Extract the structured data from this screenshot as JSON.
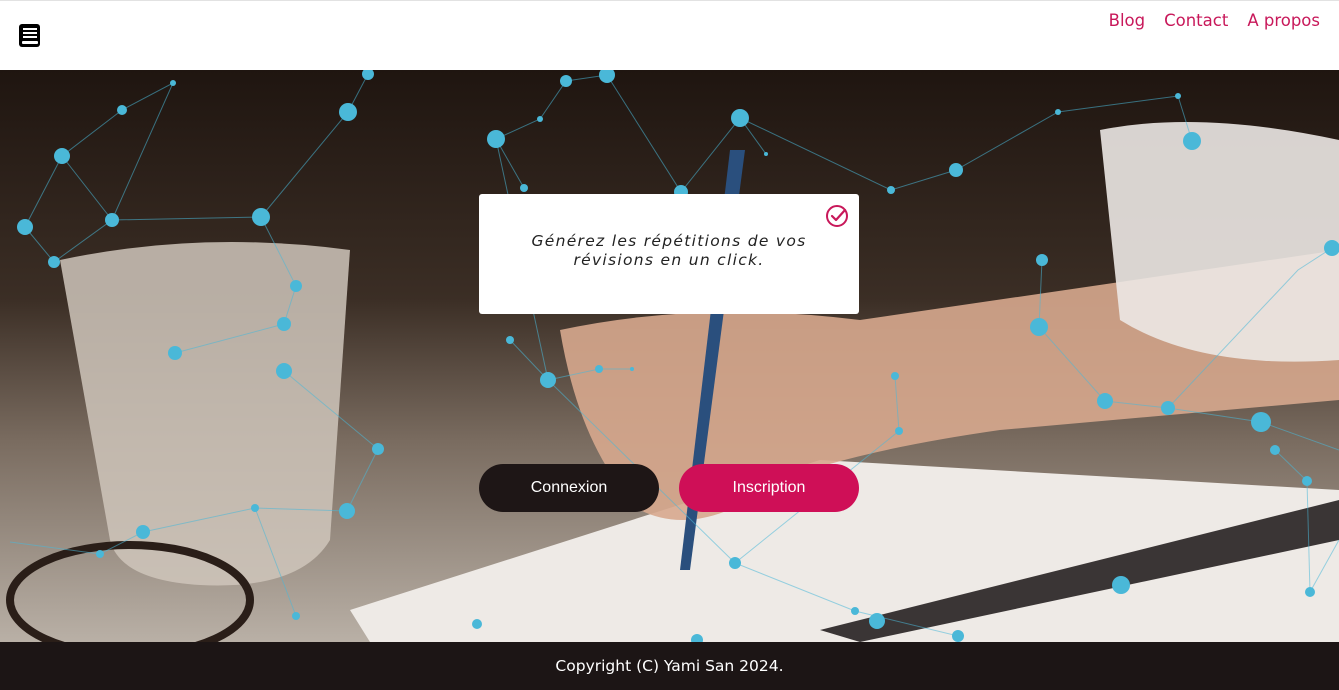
{
  "header": {
    "logo_icon": "book-icon",
    "nav": {
      "blog": "Blog",
      "contact": "Contact",
      "about": "A propos"
    }
  },
  "hero": {
    "tagline": "Générez les répétitions de vos révisions en un click.",
    "tagline_icon": "check-circle-icon",
    "login_label": "Connexion",
    "signup_label": "Inscription"
  },
  "footer": {
    "copyright": "Copyright (C) Yami San 2024."
  },
  "colors": {
    "accent": "#c8185a",
    "signup": "#cf0f57",
    "dark": "#1e1616",
    "network": "#4ab8d8"
  }
}
